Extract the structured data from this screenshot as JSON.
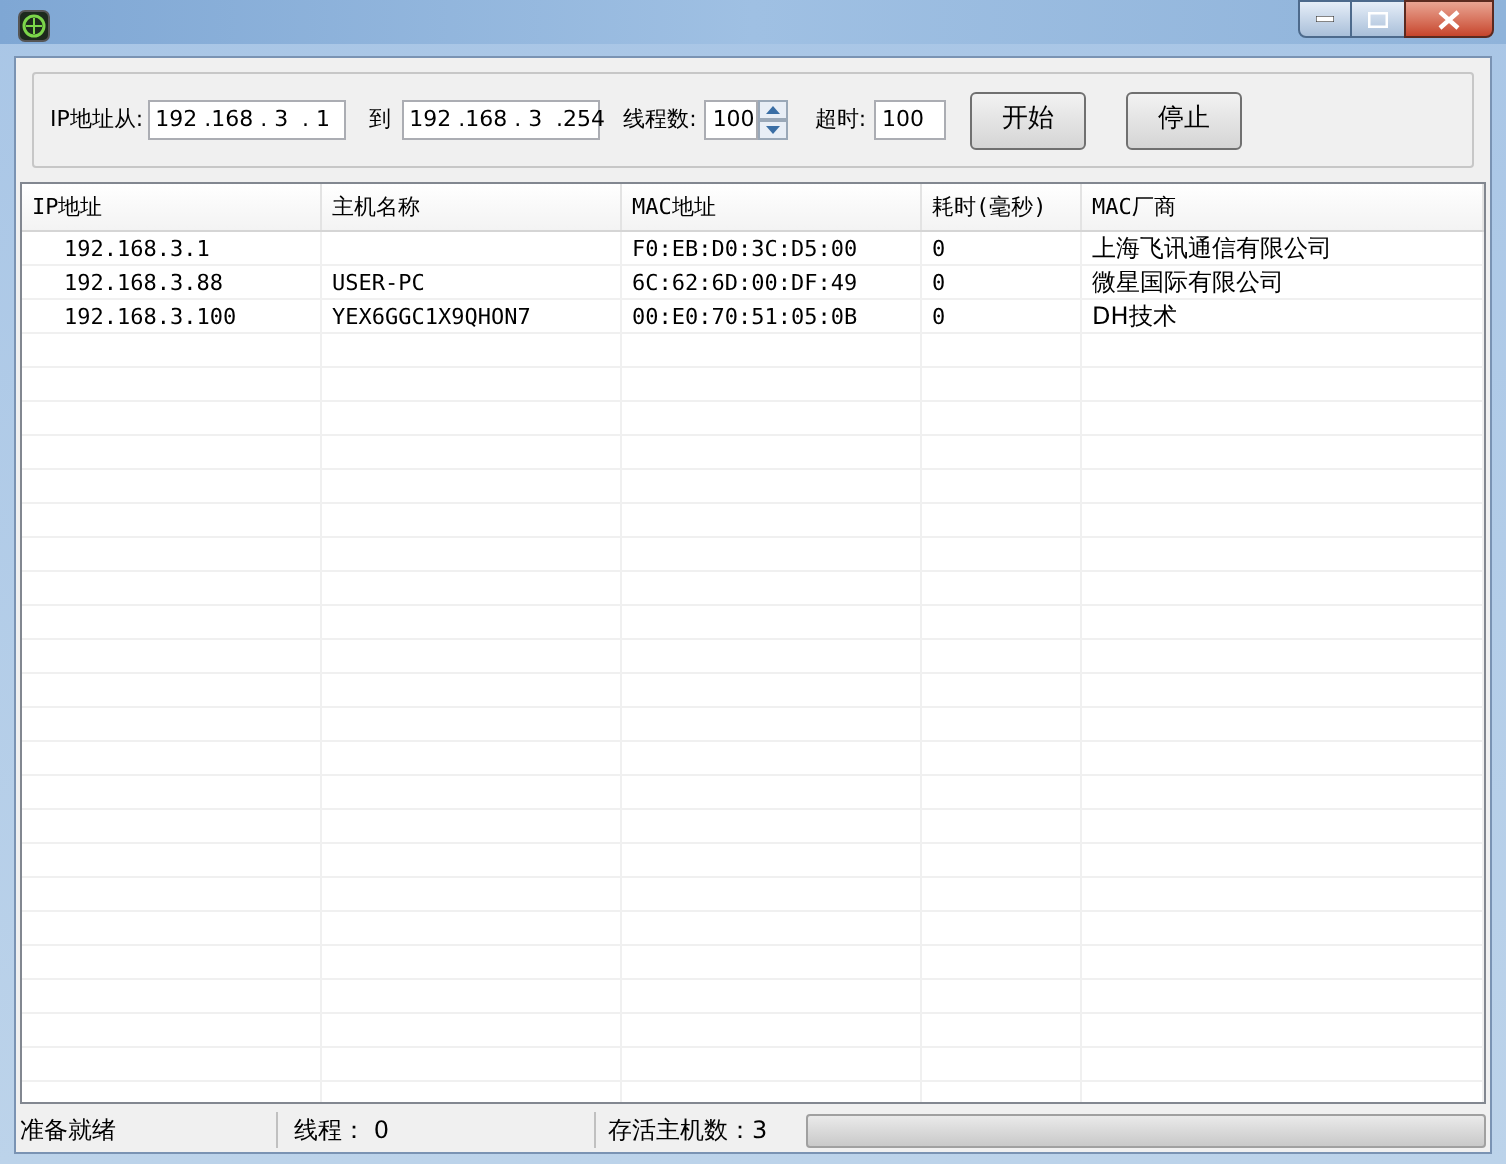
{
  "toolbar": {
    "from_label": "IP地址从:",
    "from_value": "192 .168 . 3  . 1",
    "to_label": "到",
    "to_value": "192 .168 . 3  .254",
    "threads_label": "线程数:",
    "threads_value": "100",
    "timeout_label": "超时:",
    "timeout_value": "100",
    "buttons": [
      "开始",
      "停止"
    ]
  },
  "table": {
    "columns": [
      "IP地址",
      "主机名称",
      "MAC地址",
      "耗时(毫秒)",
      "MAC厂商"
    ],
    "rows": [
      [
        "192.168.3.1",
        "",
        "F0:EB:D0:3C:D5:00",
        "0",
        "上海飞讯通信有限公司"
      ],
      [
        "192.168.3.88",
        "USER-PC",
        "6C:62:6D:00:DF:49",
        "0",
        "微星国际有限公司"
      ],
      [
        "192.168.3.100",
        "YEX6GGC1X9QHON7",
        "00:E0:70:51:05:0B",
        "0",
        "DH技术"
      ]
    ]
  },
  "status_bar": {
    "status": "准备就绪",
    "threads": "线程： 0",
    "alive": "存活主机数：3",
    "progress": {
      "level": 0
    }
  }
}
